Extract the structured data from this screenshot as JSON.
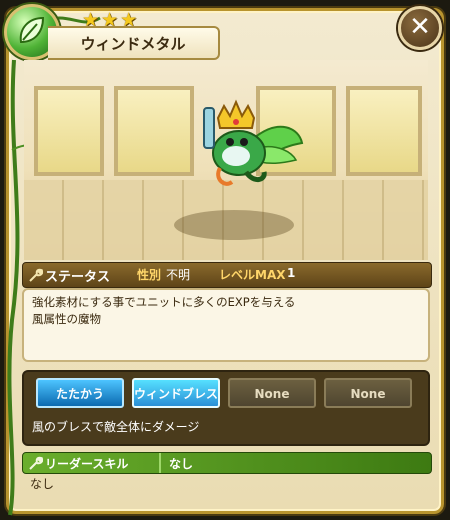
{
  "header": {
    "title": "ウィンドメタル",
    "stars": [
      "★",
      "★",
      "★"
    ],
    "close_label": "✕"
  },
  "status": {
    "label": "ステータス",
    "sex_key": "性別",
    "sex_value": "不明",
    "level_key": "レベルMAX",
    "level_value": "1"
  },
  "description": {
    "line1": "強化素材にする事でユニットに多くのEXPを与える",
    "line2": "風属性の魔物"
  },
  "skills": {
    "slots": [
      {
        "label": "たたかう"
      },
      {
        "label": "ウィンドブレス"
      },
      {
        "label": "None"
      },
      {
        "label": "None"
      }
    ],
    "detail": "風のブレスで敵全体にダメージ"
  },
  "leader": {
    "label": "リーダースキル",
    "value": "なし",
    "detail": "なし"
  },
  "colors": {
    "accent": "#b8942e",
    "leader_green": "#5a9a22",
    "skill_blue": "#1a88d0"
  }
}
